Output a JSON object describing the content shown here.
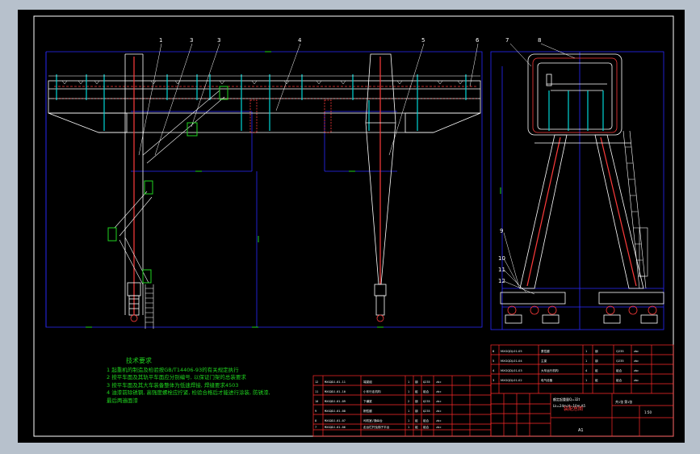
{
  "colors": {
    "frame": "#ffffff",
    "bluebox": "#2a2aff",
    "structure": "#ffffff",
    "rail": "#ff3b3b",
    "railing": "#00d6d6",
    "ladder_cage": "#1fd41f",
    "table_red": "#ff2a2a",
    "notes_text": "#1fd41f",
    "window_bg": "#b7c1cc"
  },
  "callouts": [
    "1",
    "3",
    "3",
    "4",
    "5",
    "6",
    "7",
    "8",
    "9",
    "10",
    "11",
    "12"
  ],
  "tech_notes": {
    "title": "技术要求",
    "lines": [
      "1  起重机的制造及检验按GB/T14406-93的有关规定执行",
      "2  按平车面及其轨平车面应分别编号, 以保证门架的总装要求",
      "3  按平车面及其大车装备整体为低速焊接, 焊缝要求4503",
      "4  油漆前除锈钢, 高强度螺栓应拧紧, 检验合格后才能进行涂装, 防锈漆,",
      "   最后两遍面漆"
    ]
  },
  "parts_table": {
    "rows": [
      [
        "12",
        "MXGQDJ-01-11",
        "端梁组",
        "1",
        "钢",
        "Q235",
        "zbc"
      ],
      [
        "11",
        "MXGQDJ-01-10",
        "小车行走机构",
        "1",
        "组",
        "组合",
        "zbc"
      ],
      [
        "10",
        "MXGQDJ-01-09",
        "下横梁",
        "2",
        "钢",
        "Q235",
        "zbc"
      ],
      [
        "9",
        "MXGQDJ-01-08",
        "刚性腿",
        "1",
        "钢",
        "Q235",
        "zbc"
      ],
      [
        "8",
        "MXGQDJ-01-07",
        "司机室/操纵台",
        "1",
        "组",
        "组合",
        "zbc"
      ],
      [
        "7",
        "MXGQDJ-01-06",
        "走台栏杆及梯子平台",
        "1",
        "组",
        "组合",
        "zbc"
      ]
    ]
  },
  "main_table": {
    "rows": [
      [
        "6",
        "MXGQDJ-01-05",
        "柔性腿",
        "1",
        "钢",
        "Q235",
        "zbc"
      ],
      [
        "5",
        "MXGQDJ-01-04",
        "主梁",
        "1",
        "钢",
        "Q235",
        "zbc"
      ],
      [
        "4",
        "MXGQDJ-01-03",
        "大车运行机构",
        "4",
        "组",
        "组合",
        "zbc"
      ],
      [
        "3",
        "MXGQDJ-01-02",
        "电气设备",
        "1",
        "组",
        "组合",
        "zbc"
      ]
    ],
    "spec": "额定起重量Q=32t",
    "spec2": "Lk=24m,H=10m,A5",
    "drawing_title": "装配总图",
    "scale": "1:50",
    "sheet": "共1张 第1张",
    "sheet_mark": "A1"
  }
}
